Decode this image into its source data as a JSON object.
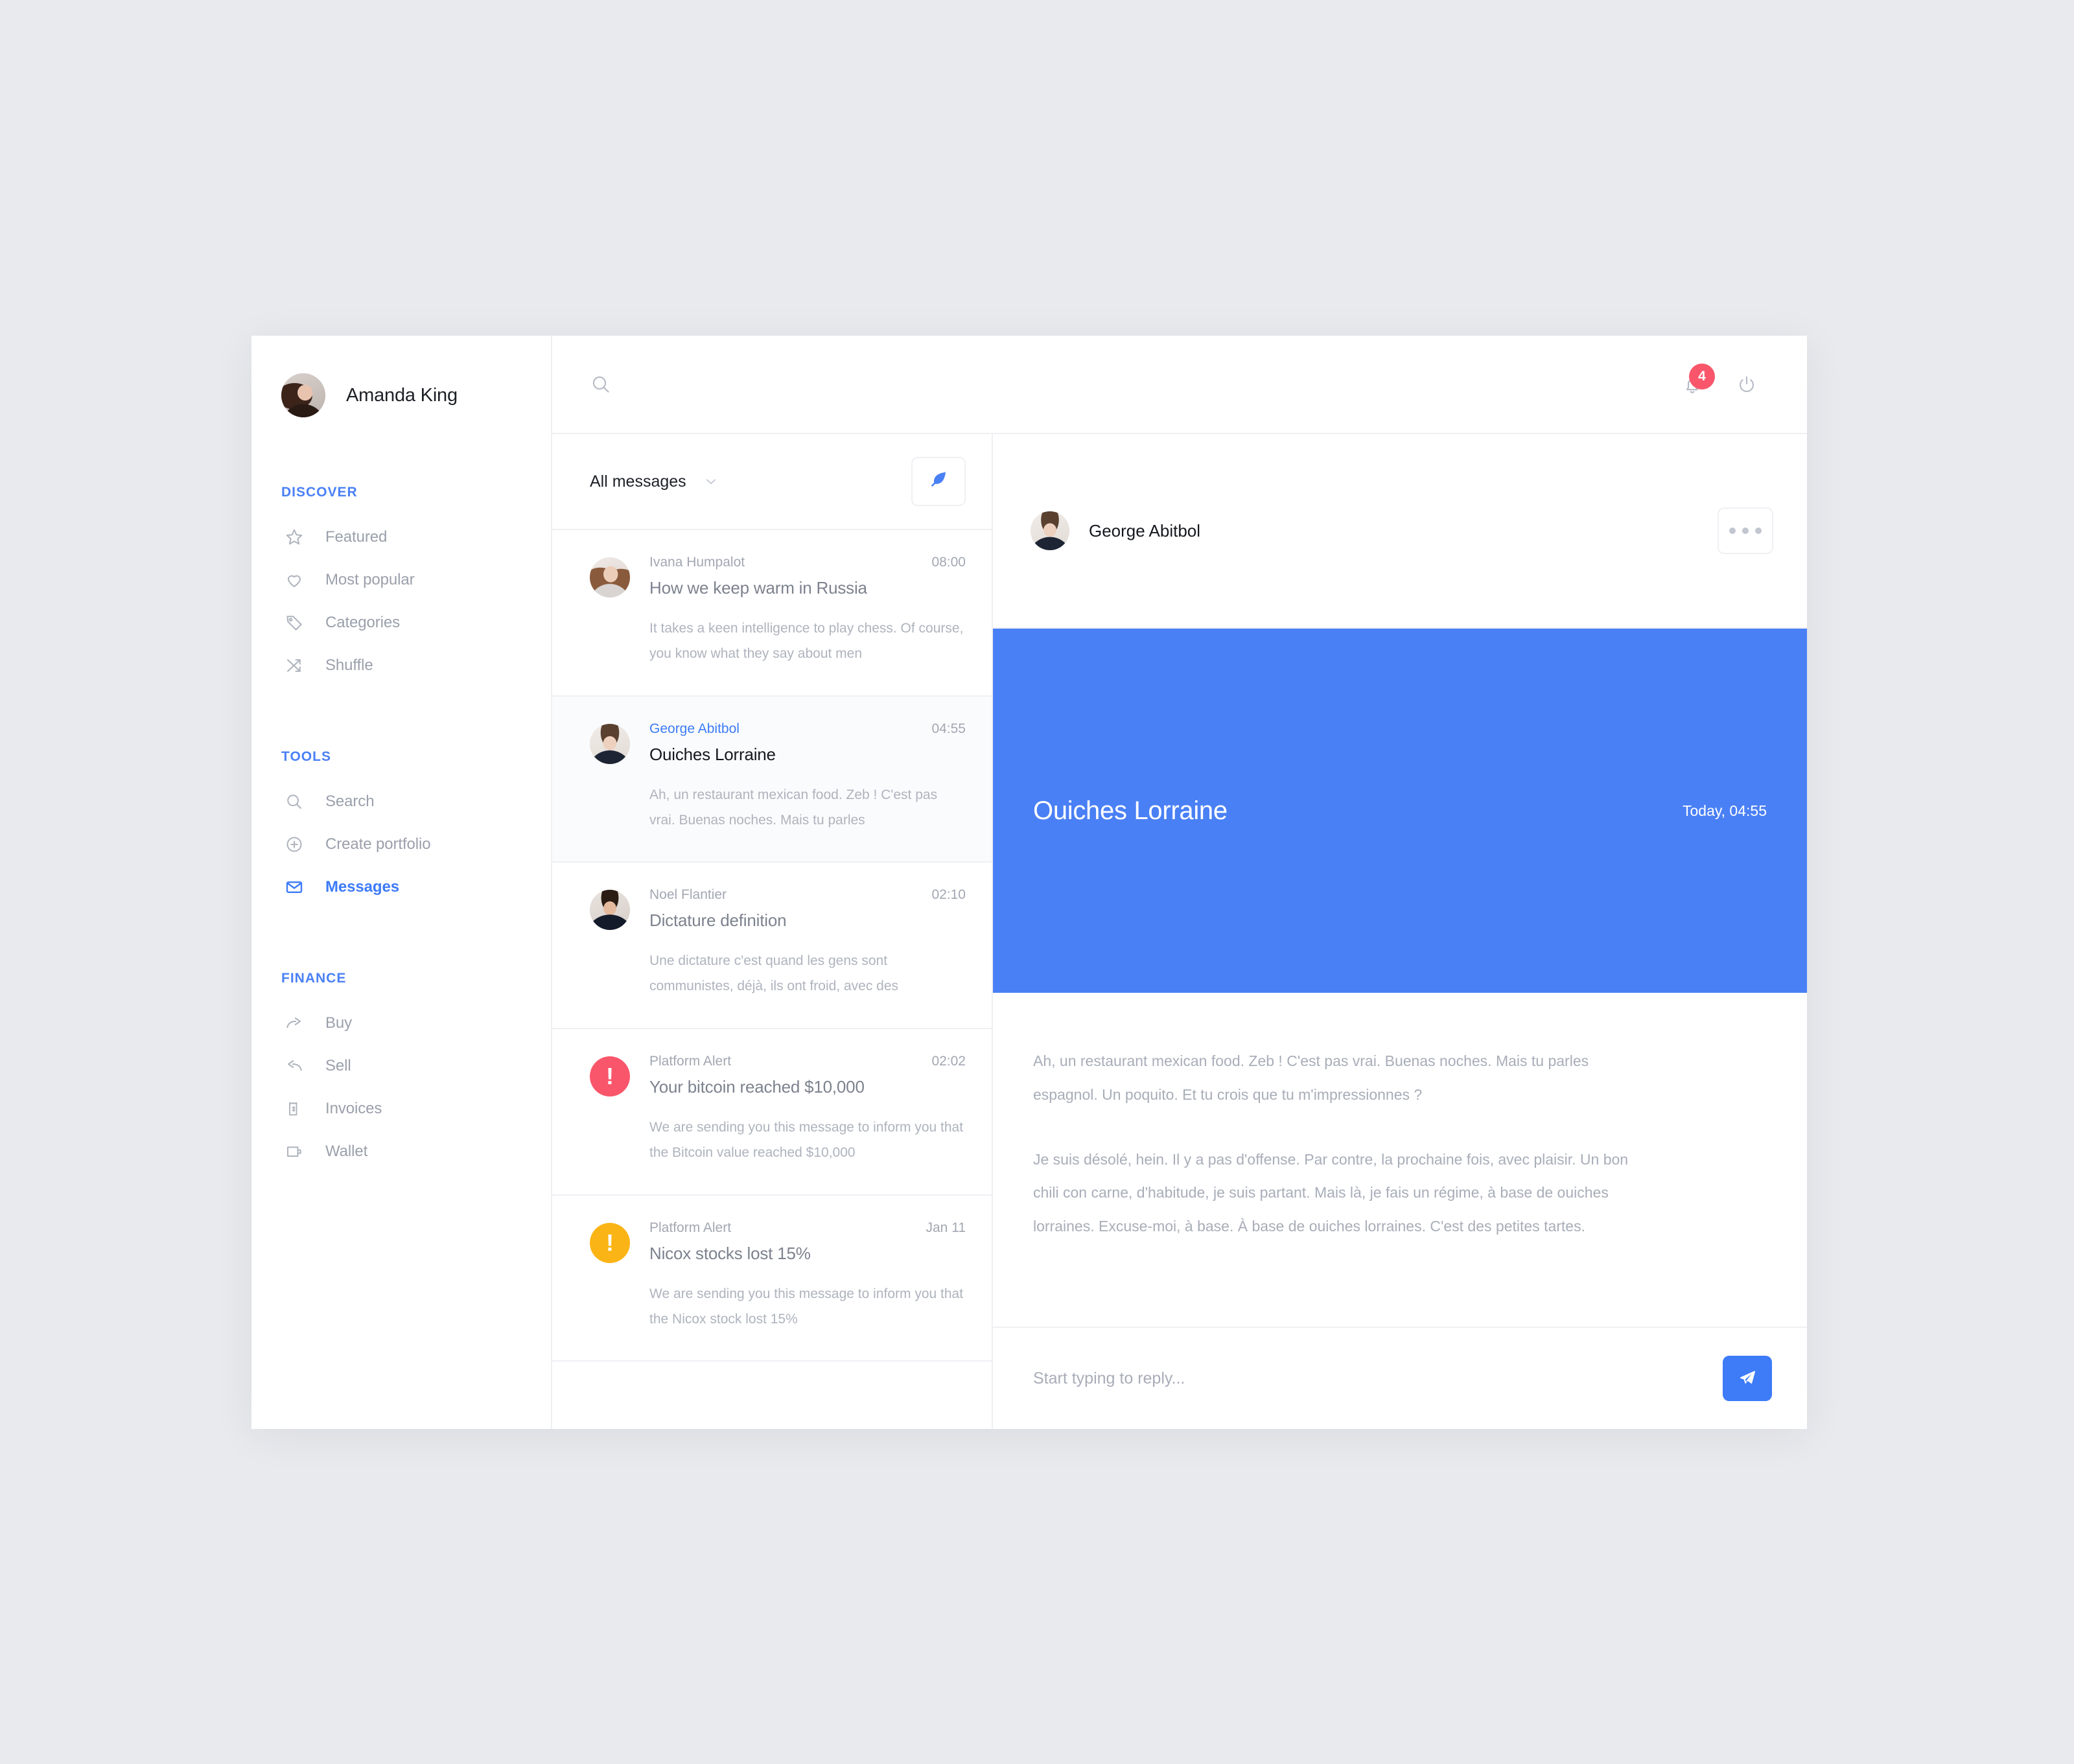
{
  "profile": {
    "name": "Amanda King",
    "avatar_icon": "avatar-amanda"
  },
  "sidebar": {
    "sections": [
      {
        "title": "DISCOVER",
        "items": [
          {
            "label": "Featured",
            "icon": "star-icon",
            "active": false
          },
          {
            "label": "Most popular",
            "icon": "heart-icon",
            "active": false
          },
          {
            "label": "Categories",
            "icon": "tag-icon",
            "active": false
          },
          {
            "label": "Shuffle",
            "icon": "shuffle-icon",
            "active": false
          }
        ]
      },
      {
        "title": "TOOLS",
        "items": [
          {
            "label": "Search",
            "icon": "search-icon",
            "active": false
          },
          {
            "label": "Create portfolio",
            "icon": "plus-circle-icon",
            "active": false
          },
          {
            "label": "Messages",
            "icon": "envelope-icon",
            "active": true
          }
        ]
      },
      {
        "title": "FINANCE",
        "items": [
          {
            "label": "Buy",
            "icon": "arrow-forward-icon",
            "active": false
          },
          {
            "label": "Sell",
            "icon": "arrow-reply-icon",
            "active": false
          },
          {
            "label": "Invoices",
            "icon": "receipt-dollar-icon",
            "active": false
          },
          {
            "label": "Wallet",
            "icon": "wallet-icon",
            "active": false
          }
        ]
      }
    ]
  },
  "topbar": {
    "search_placeholder": "",
    "search_icon": "search-icon",
    "notifications_icon": "bell-icon",
    "notifications_count": "4",
    "power_icon": "power-icon"
  },
  "list_header": {
    "filter_label": "All messages",
    "filter_chevron": "chevron-down-icon",
    "compose_icon": "feather-icon"
  },
  "messages": [
    {
      "from": "Ivana Humpalot",
      "time": "08:00",
      "subject": "How we keep warm in Russia",
      "preview": "It takes a keen intelligence to play chess. Of course, you know what they say about men",
      "avatar_icon": "avatar-ivana",
      "type": "person",
      "selected": false
    },
    {
      "from": "George Abitbol",
      "time": "04:55",
      "subject": "Ouiches Lorraine",
      "preview": "Ah, un restaurant mexican food. Zeb ! C'est pas vrai. Buenas noches. Mais tu parles",
      "avatar_icon": "avatar-george",
      "type": "person",
      "selected": true
    },
    {
      "from": "Noel Flantier",
      "time": "02:10",
      "subject": "Dictature definition",
      "preview": "Une dictature c'est quand les gens sont communistes, déjà, ils ont froid, avec des",
      "avatar_icon": "avatar-noel",
      "type": "person",
      "selected": false
    },
    {
      "from": "Platform Alert",
      "time": "02:02",
      "subject": "Your bitcoin reached $10,000",
      "preview": "We are sending you this message to inform you that the Bitcoin value reached $10,000",
      "avatar_icon": "alert-exclamation-icon",
      "type": "alert",
      "alert_color": "#f9566b",
      "alert_glyph": "!",
      "selected": false
    },
    {
      "from": "Platform Alert",
      "time": "Jan 11",
      "subject": "Nicox stocks lost 15%",
      "preview": "We are sending you this message to inform you that the Nicox stock lost 15%",
      "avatar_icon": "alert-exclamation-icon",
      "type": "alert",
      "alert_color": "#fbb415",
      "alert_glyph": "!",
      "selected": false
    }
  ],
  "conversation": {
    "peer_name": "George Abitbol",
    "peer_avatar_icon": "avatar-george",
    "more_icon": "ellipsis-icon",
    "hero": {
      "title": "Ouiches Lorraine",
      "time": "Today, 04:55",
      "background_color": "#4a80f5"
    },
    "paragraphs": [
      "Ah, un restaurant mexican food. Zeb ! C'est pas vrai. Buenas noches. Mais tu parles espagnol. Un poquito. Et tu crois que tu m'impressionnes ?",
      "Je suis désolé, hein. Il y a pas d'offense. Par contre, la prochaine fois, avec plaisir. Un bon chili con carne, d'habitude, je suis partant. Mais là, je fais un régime, à base de ouiches lorraines. Excuse-moi, à base. À base de ouiches lorraines. C'est des petites tartes."
    ],
    "composer": {
      "placeholder": "Start typing to reply...",
      "value": "",
      "send_icon": "paper-plane-icon"
    }
  },
  "colors": {
    "accent": "#4a80f5",
    "accent_strong": "#3d7bf7",
    "alert_red": "#f9566b",
    "alert_yellow": "#fbb415",
    "page_background": "#e9eaee",
    "divider": "#eef0f3"
  }
}
